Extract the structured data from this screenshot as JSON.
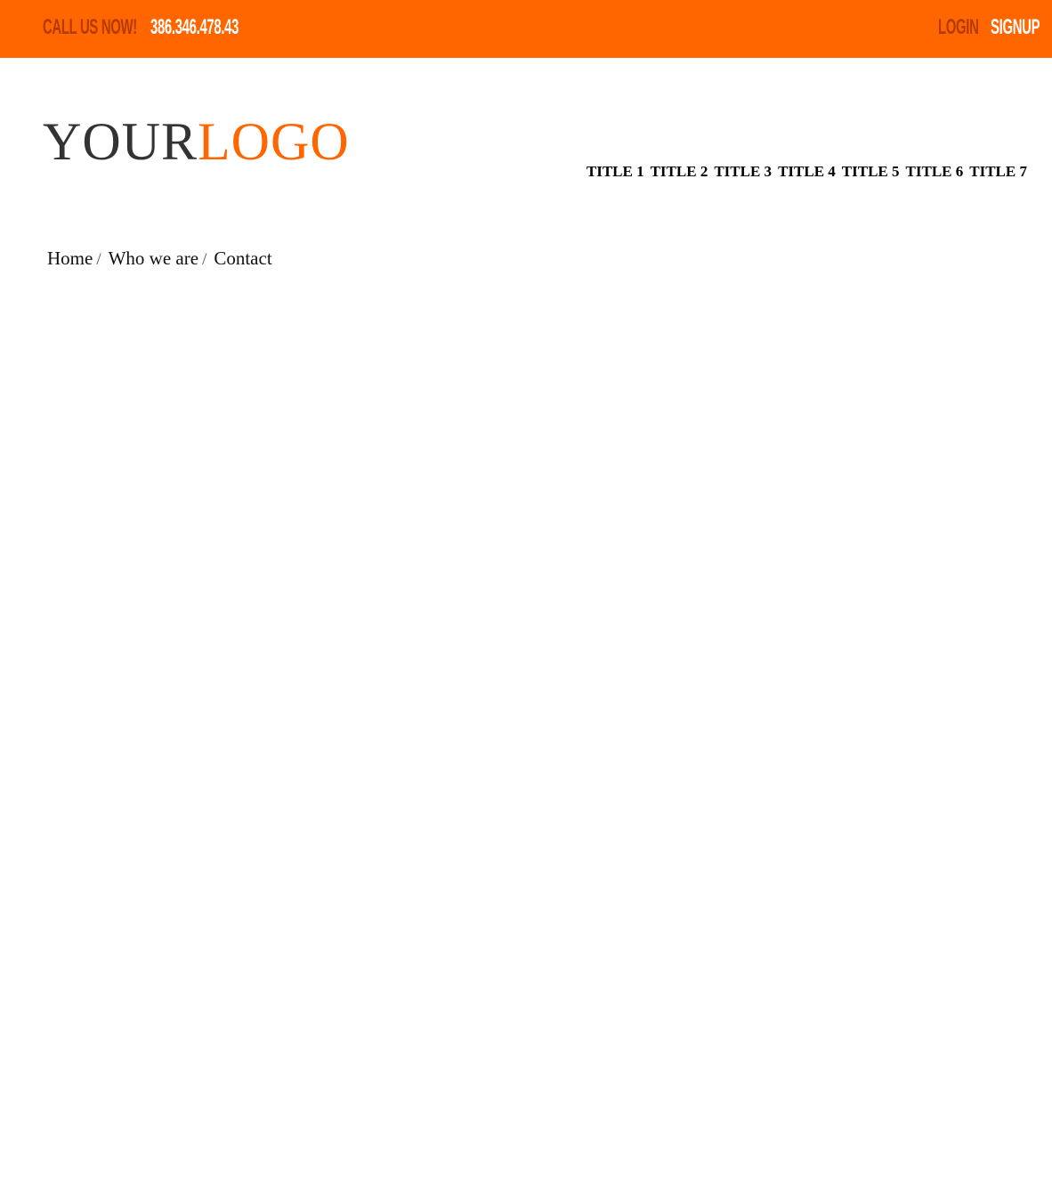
{
  "topbar": {
    "call_label": "CALL US NOW!",
    "phone": "386.346.478.43",
    "login_label": "LOGIN",
    "signup_label": "SIGNUP",
    "background_color": "#ff6600",
    "accent_dark": "#b33a00"
  },
  "logo": {
    "part1": "YOUR",
    "part2": "LOGO"
  },
  "nav": {
    "items": [
      {
        "label": "TITLE 1"
      },
      {
        "label": "TITLE 2"
      },
      {
        "label": "TITLE 3"
      },
      {
        "label": "TITLE 4"
      },
      {
        "label": "TITLE 5"
      },
      {
        "label": "TITLE 6"
      },
      {
        "label": "TITLE 7"
      }
    ]
  },
  "breadcrumb": {
    "separator": "/",
    "items": [
      {
        "label": "Home"
      },
      {
        "label": "Who we are"
      },
      {
        "label": "Contact"
      }
    ]
  }
}
